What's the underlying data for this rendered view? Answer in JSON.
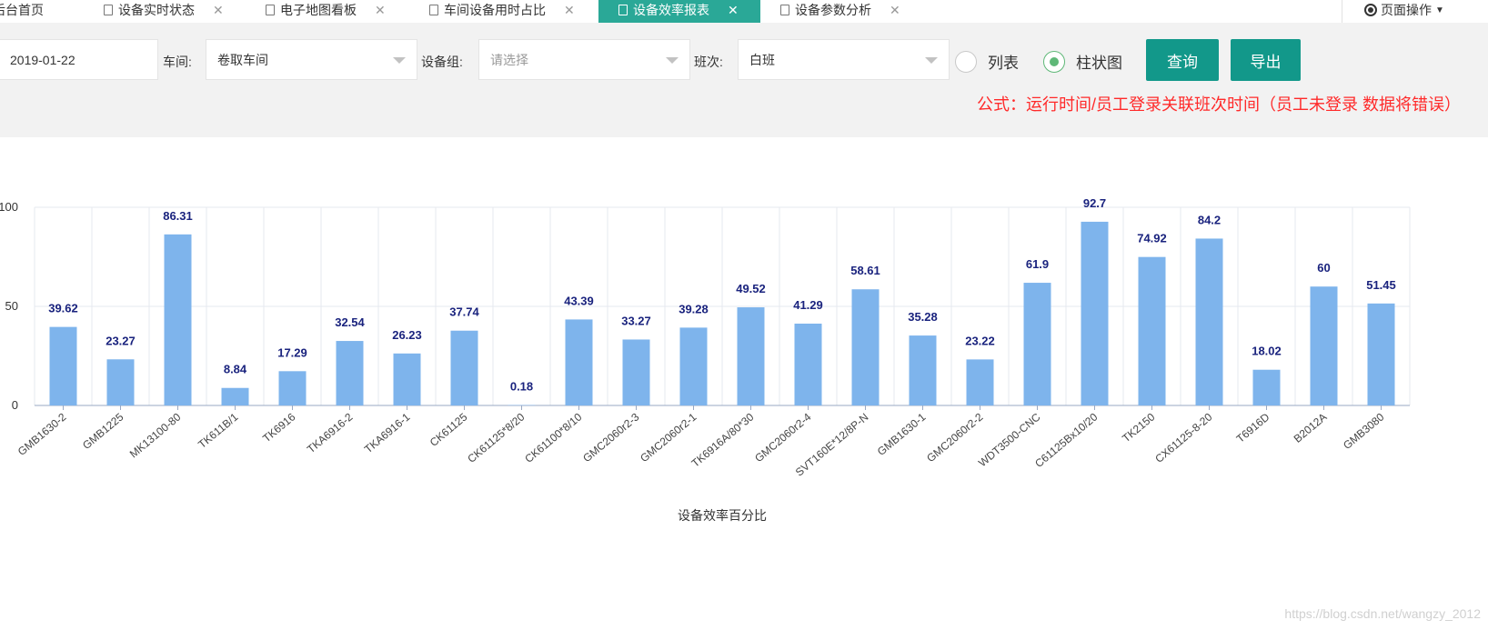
{
  "tabs": [
    {
      "label": "后台首页",
      "active": false
    },
    {
      "label": "设备实时状态",
      "active": false
    },
    {
      "label": "电子地图看板",
      "active": false
    },
    {
      "label": "车间设备用时占比",
      "active": false
    },
    {
      "label": "设备效率报表",
      "active": true
    },
    {
      "label": "设备参数分析",
      "active": false
    }
  ],
  "page_ops_label": "页面操作",
  "filters": {
    "date_value": "2019-01-22",
    "workshop_label": "车间:",
    "workshop_value": "卷取车间",
    "group_label": "设备组:",
    "group_placeholder": "请选择",
    "shift_label": "班次:",
    "shift_value": "白班",
    "view_list_label": "列表",
    "view_bar_label": "柱状图",
    "view_selected": "柱状图",
    "query_button": "查询",
    "export_button": "导出",
    "formula": "公式：运行时间/员工登录关联班次时间（员工未登录 数据将错误）"
  },
  "colors": {
    "accent": "#12988a",
    "tab_active": "#2aa897",
    "bar": "#7eb4ec",
    "label": "#1a237e",
    "formula": "#ff2a2a"
  },
  "chart_data": {
    "type": "bar",
    "xlabel": "设备效率百分比",
    "ylabel": "",
    "ylim": [
      0,
      100
    ],
    "yticks": [
      "0",
      "50",
      "100"
    ],
    "grid": true,
    "categories": [
      "GMB1630-2",
      "GMB1225",
      "MK13100-80",
      "TK611B/1",
      "TK6916",
      "TKA6916-2",
      "TKA6916-1",
      "CK61125",
      "CK61125*8/20",
      "CK61100*8/10",
      "GMC2060r2-3",
      "GMC2060r2-1",
      "TK6916A/80*30",
      "GMC2060r2-4",
      "SVT160E*12/8P-N",
      "GMB1630-1",
      "GMC2060r2-2",
      "WDT3500-CNC",
      "C61125Bx10/20",
      "TK2150",
      "CX61125-8-20",
      "T6916D",
      "B2012A",
      "GMB3080"
    ],
    "values": [
      39.62,
      23.27,
      86.31,
      8.84,
      17.29,
      32.54,
      26.23,
      37.74,
      0.18,
      43.39,
      33.27,
      39.28,
      49.52,
      41.29,
      58.61,
      35.28,
      23.22,
      61.9,
      92.7,
      74.92,
      84.2,
      18.02,
      60,
      51.45
    ],
    "value_labels": [
      "39.62",
      "23.27",
      "86.31",
      "8.84",
      "17.29",
      "32.54",
      "26.23",
      "37.74",
      "0.18",
      "43.39",
      "33.27",
      "39.28",
      "49.52",
      "41.29",
      "58.61",
      "35.28",
      "23.22",
      "61.9",
      "92.7",
      "74.92",
      "84.2",
      "18.02",
      "60",
      "51.45"
    ]
  },
  "watermark": "https://blog.csdn.net/wangzy_2012"
}
